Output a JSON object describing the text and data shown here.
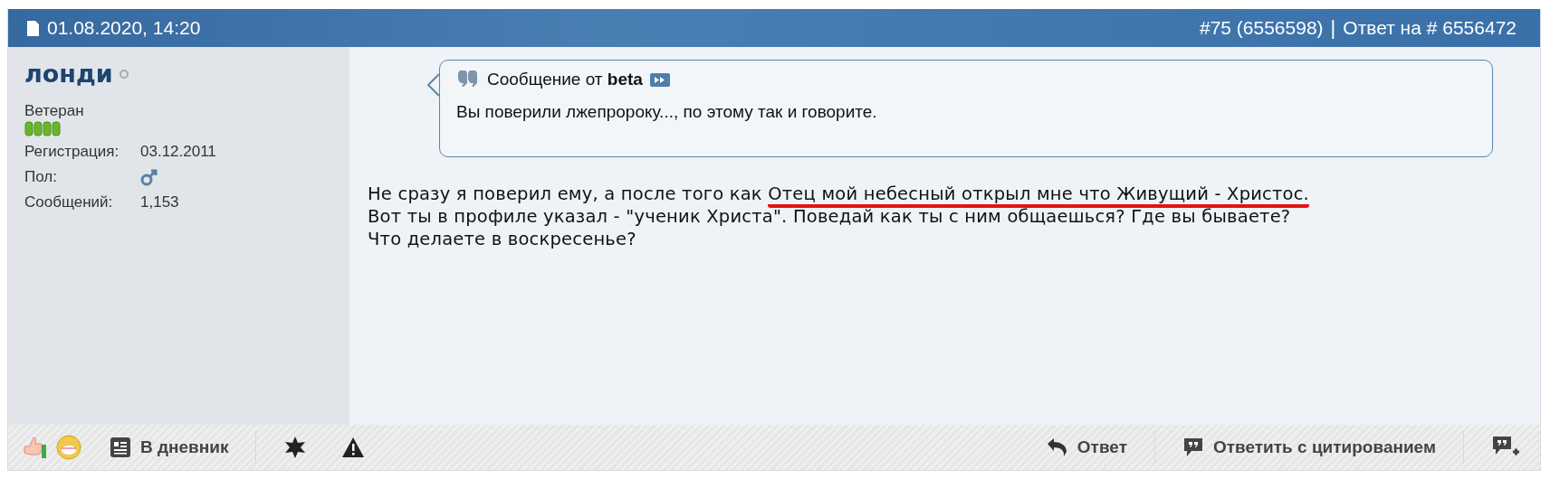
{
  "header": {
    "date": "01.08.2020, 14:20",
    "post_number": "#75 (6556598)",
    "separator": "|",
    "reply_to": "Ответ на # 6556472"
  },
  "user": {
    "name": "лонди",
    "online": false,
    "rank": "Ветеран",
    "registration_label": "Регистрация:",
    "registration": "03.12.2011",
    "gender_label": "Пол:",
    "posts_label": "Сообщений:",
    "posts": "1,153"
  },
  "quote": {
    "prefix": "Сообщение от",
    "author": "beta",
    "text": "Вы поверили лжепророку..., по этому так и говорите."
  },
  "post": {
    "before": "Не сразу я поверил ему, а после того как ",
    "underlined": "Отец мой небесный открыл мне что Живущий - Христос.",
    "after": "\nВот ты в профиле указал - \"ученик Христа\". Поведай как ты с ним общаешься? Где вы бываете?\nЧто делаете в воскресенье?"
  },
  "toolbar": {
    "diary": "В дневник",
    "reply": "Ответ",
    "quote_reply": "Ответить с цитированием"
  }
}
